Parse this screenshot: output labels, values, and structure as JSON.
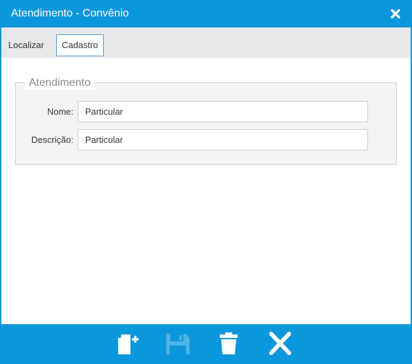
{
  "window": {
    "title": "Atendimento - Convênio"
  },
  "tabs": [
    {
      "label": "Localizar",
      "active": false
    },
    {
      "label": "Cadastro",
      "active": true
    }
  ],
  "form": {
    "legend": "Atendimento",
    "fields": [
      {
        "label": "Nome:",
        "value": "Particular"
      },
      {
        "label": "Descrição:",
        "value": "Particular"
      }
    ]
  },
  "toolbar": {
    "icons": [
      "new-document-icon",
      "save-icon",
      "trash-icon",
      "cancel-icon"
    ]
  },
  "colors": {
    "accent": "#0b97db",
    "tab_border": "#4aa3d8",
    "disabled_icon": "#4fb2e6"
  }
}
